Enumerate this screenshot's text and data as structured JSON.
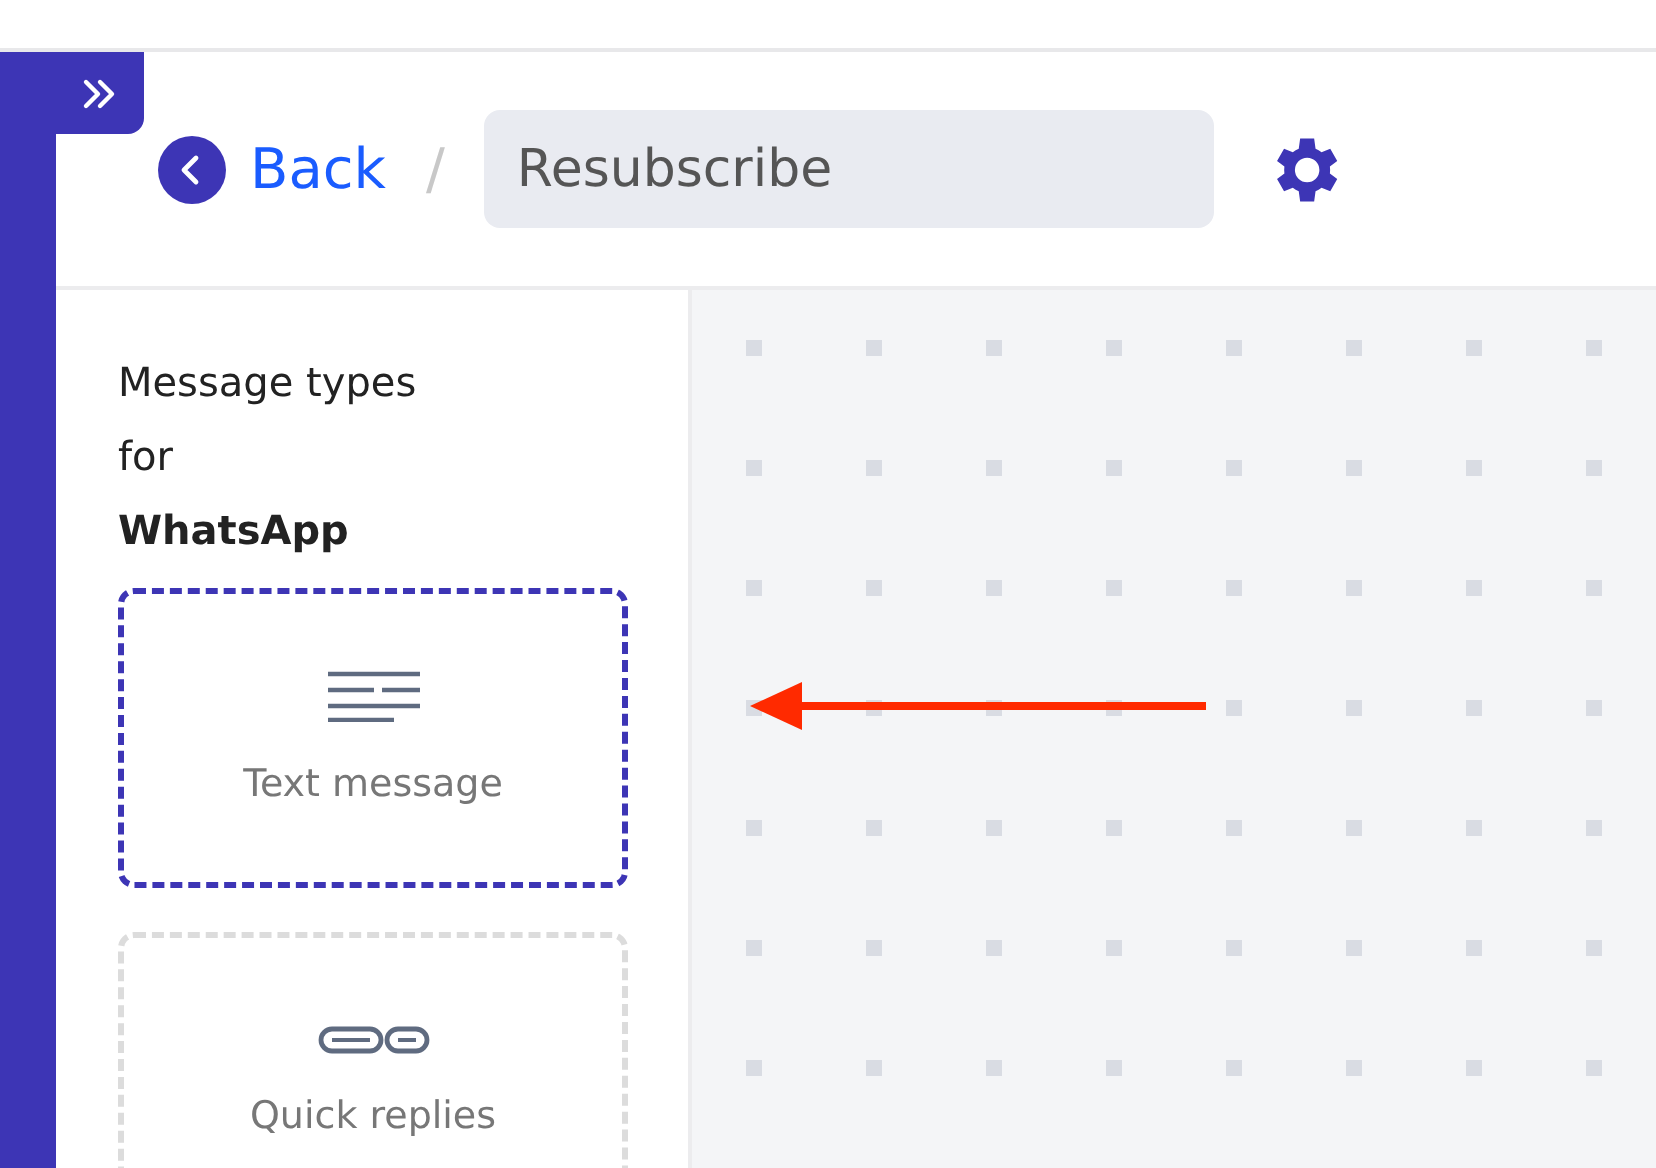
{
  "breadcrumb": {
    "back": "Back",
    "separator": "/",
    "title_field": "Resubscribe"
  },
  "palette": {
    "heading": "Message types\nfor\n**WhatsApp**",
    "items": [
      {
        "label": "Text message",
        "kind": "text",
        "selected": true
      },
      {
        "label": "Quick replies",
        "kind": "quick",
        "selected": false
      }
    ]
  }
}
